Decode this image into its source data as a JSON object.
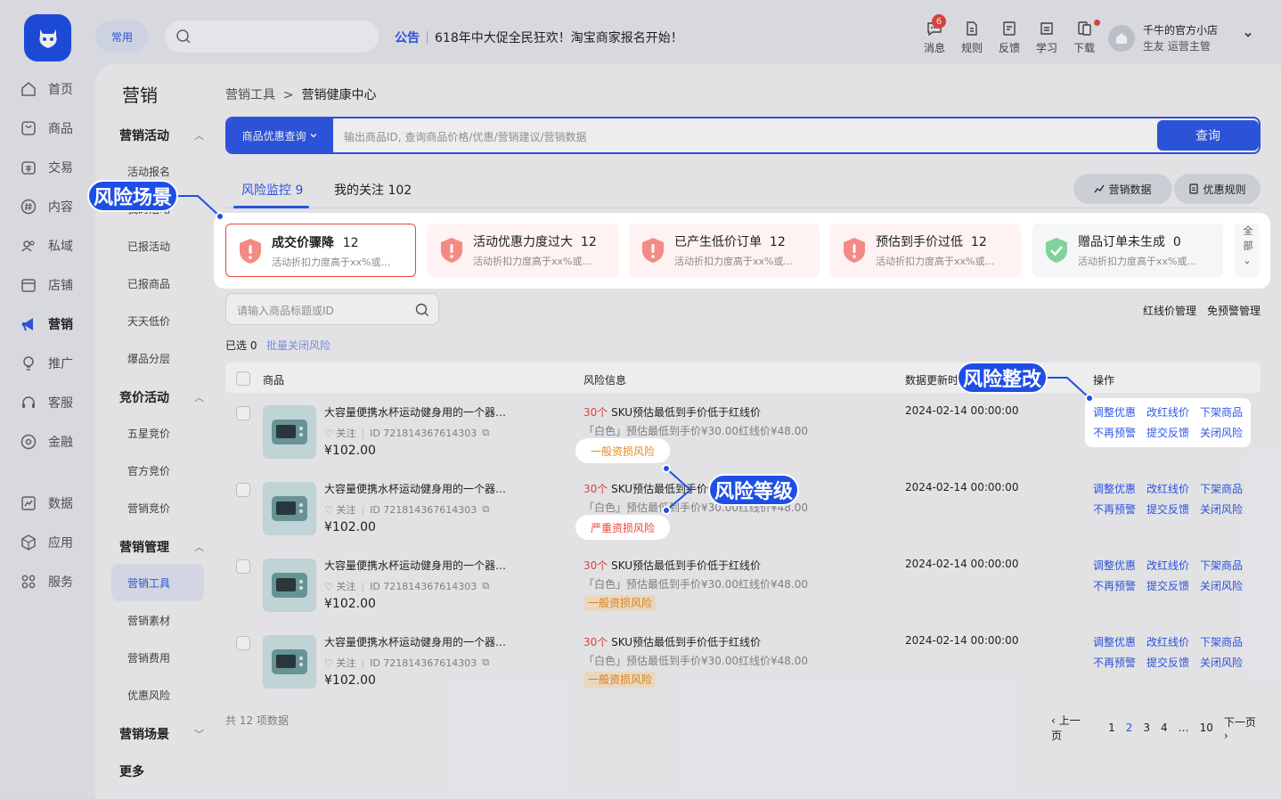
{
  "header": {
    "common_label": "常用",
    "notice_tag": "公告",
    "notice_text": "618年中大促全民狂欢！淘宝商家报名开始！",
    "tools": [
      {
        "label": "消息",
        "badge": "6"
      },
      {
        "label": "规则"
      },
      {
        "label": "反馈"
      },
      {
        "label": "学习"
      },
      {
        "label": "下载"
      }
    ],
    "user_name": "千牛的官方小店",
    "user_role": "生友  运营主管"
  },
  "leftnav": [
    {
      "label": "首页"
    },
    {
      "label": "商品"
    },
    {
      "label": "交易"
    },
    {
      "label": "内容"
    },
    {
      "label": "私域"
    },
    {
      "label": "店铺"
    },
    {
      "label": "营销"
    },
    {
      "label": "推广"
    },
    {
      "label": "客服"
    },
    {
      "label": "金融"
    },
    {
      "label": "数据"
    },
    {
      "label": "应用"
    },
    {
      "label": "服务"
    }
  ],
  "subnav": {
    "title": "营销",
    "groups": [
      {
        "label": "营销活动",
        "items": [
          "活动报名",
          "我的活动",
          "已报活动",
          "已报商品",
          "天天低价",
          "爆品分层"
        ]
      },
      {
        "label": "竞价活动",
        "items": [
          "五星竞价",
          "官方竞价",
          "营销竞价"
        ]
      },
      {
        "label": "营销管理",
        "items": [
          "营销工具",
          "营销素材",
          "营销费用",
          "优惠风险"
        ]
      },
      {
        "label": "营销场景",
        "items": []
      },
      {
        "label": "更多",
        "items": []
      }
    ]
  },
  "breadcrumb": {
    "parent": "营销工具",
    "current": "营销健康中心"
  },
  "search": {
    "scope_label": "商品优惠查询",
    "placeholder": "输出商品ID, 查询商品价格/优惠/营销建议/营销数据",
    "button": "查询"
  },
  "tabs": [
    {
      "label": "风险监控 9"
    },
    {
      "label": "我的关注 102"
    }
  ],
  "tab_buttons": {
    "data": "营销数据",
    "rules": "优惠规则"
  },
  "scenes": [
    {
      "title": "成交价骤降",
      "count": "12",
      "desc": "活动折扣力度高于xx%或…",
      "status": "risk"
    },
    {
      "title": "活动优惠力度过大",
      "count": "12",
      "desc": "活动折扣力度高于xx%或…",
      "status": "risk"
    },
    {
      "title": "已产生低价订单",
      "count": "12",
      "desc": "活动折扣力度高于xx%或…",
      "status": "risk"
    },
    {
      "title": "预估到手价过低",
      "count": "12",
      "desc": "活动折扣力度高于xx%或…",
      "status": "risk"
    },
    {
      "title": "赠品订单未生成",
      "count": "0",
      "desc": "活动折扣力度高于xx%或…",
      "status": "ok"
    }
  ],
  "all_label": "全部",
  "filter": {
    "placeholder": "请输入商品标题或ID",
    "redline": "红线价管理",
    "exempt": "免预警管理",
    "selected": "已选 0",
    "batch": "批量关闭风险"
  },
  "table": {
    "headers": {
      "product": "商品",
      "risk": "风险信息",
      "updated": "数据更新时间",
      "ops": "操作"
    },
    "rows": [
      {
        "title": "大容量便携水杯运动健身用的一个器…",
        "follow": "关注",
        "id": "ID  721814367614303",
        "price": "¥102.00",
        "risk_count": "30个",
        "risk_text": " SKU预估最低到手价低于红线价",
        "risk_detail": "「白色」预估最低到手价¥30.00红线价¥48.00",
        "level": "一般资损风险",
        "level_type": "normal",
        "date": "2024-02-14 00:00:00"
      },
      {
        "title": "大容量便携水杯运动健身用的一个器…",
        "follow": "关注",
        "id": "ID  721814367614303",
        "price": "¥102.00",
        "risk_count": "30个",
        "risk_text": " SKU预估最低到手价低于红线价",
        "risk_detail": "「白色」预估最低到手价¥30.00红线价¥48.00",
        "level": "严重资损风险",
        "level_type": "severe",
        "date": "2024-02-14 00:00:00"
      },
      {
        "title": "大容量便携水杯运动健身用的一个器…",
        "follow": "关注",
        "id": "ID  721814367614303",
        "price": "¥102.00",
        "risk_count": "30个",
        "risk_text": " SKU预估最低到手价低于红线价",
        "risk_detail": "「白色」预估最低到手价¥30.00红线价¥48.00",
        "level": "一般资损风险",
        "level_type": "normal",
        "date": "2024-02-14 00:00:00"
      },
      {
        "title": "大容量便携水杯运动健身用的一个器…",
        "follow": "关注",
        "id": "ID  721814367614303",
        "price": "¥102.00",
        "risk_count": "30个",
        "risk_text": " SKU预估最低到手价低于红线价",
        "risk_detail": "「白色」预估最低到手价¥30.00红线价¥48.00",
        "level": "一般资损风险",
        "level_type": "normal",
        "date": "2024-02-14 00:00:00"
      }
    ],
    "actions": [
      "调整优惠",
      "改红线价",
      "下架商品",
      "不再预警",
      "提交反馈",
      "关闭风险"
    ]
  },
  "pagination": {
    "total": "共 12 项数据",
    "prev": "上一页",
    "pages": [
      "1",
      "2",
      "3",
      "4",
      "…",
      "10"
    ],
    "current": "2",
    "next": "下一页"
  },
  "callouts": {
    "scene": "风险场景",
    "rectify": "风险整改",
    "level": "风险等级"
  },
  "colors": {
    "primary": "#2e57e6",
    "danger": "#e8463a",
    "warning": "#e88a1a",
    "callout": "#1e4ee6"
  }
}
